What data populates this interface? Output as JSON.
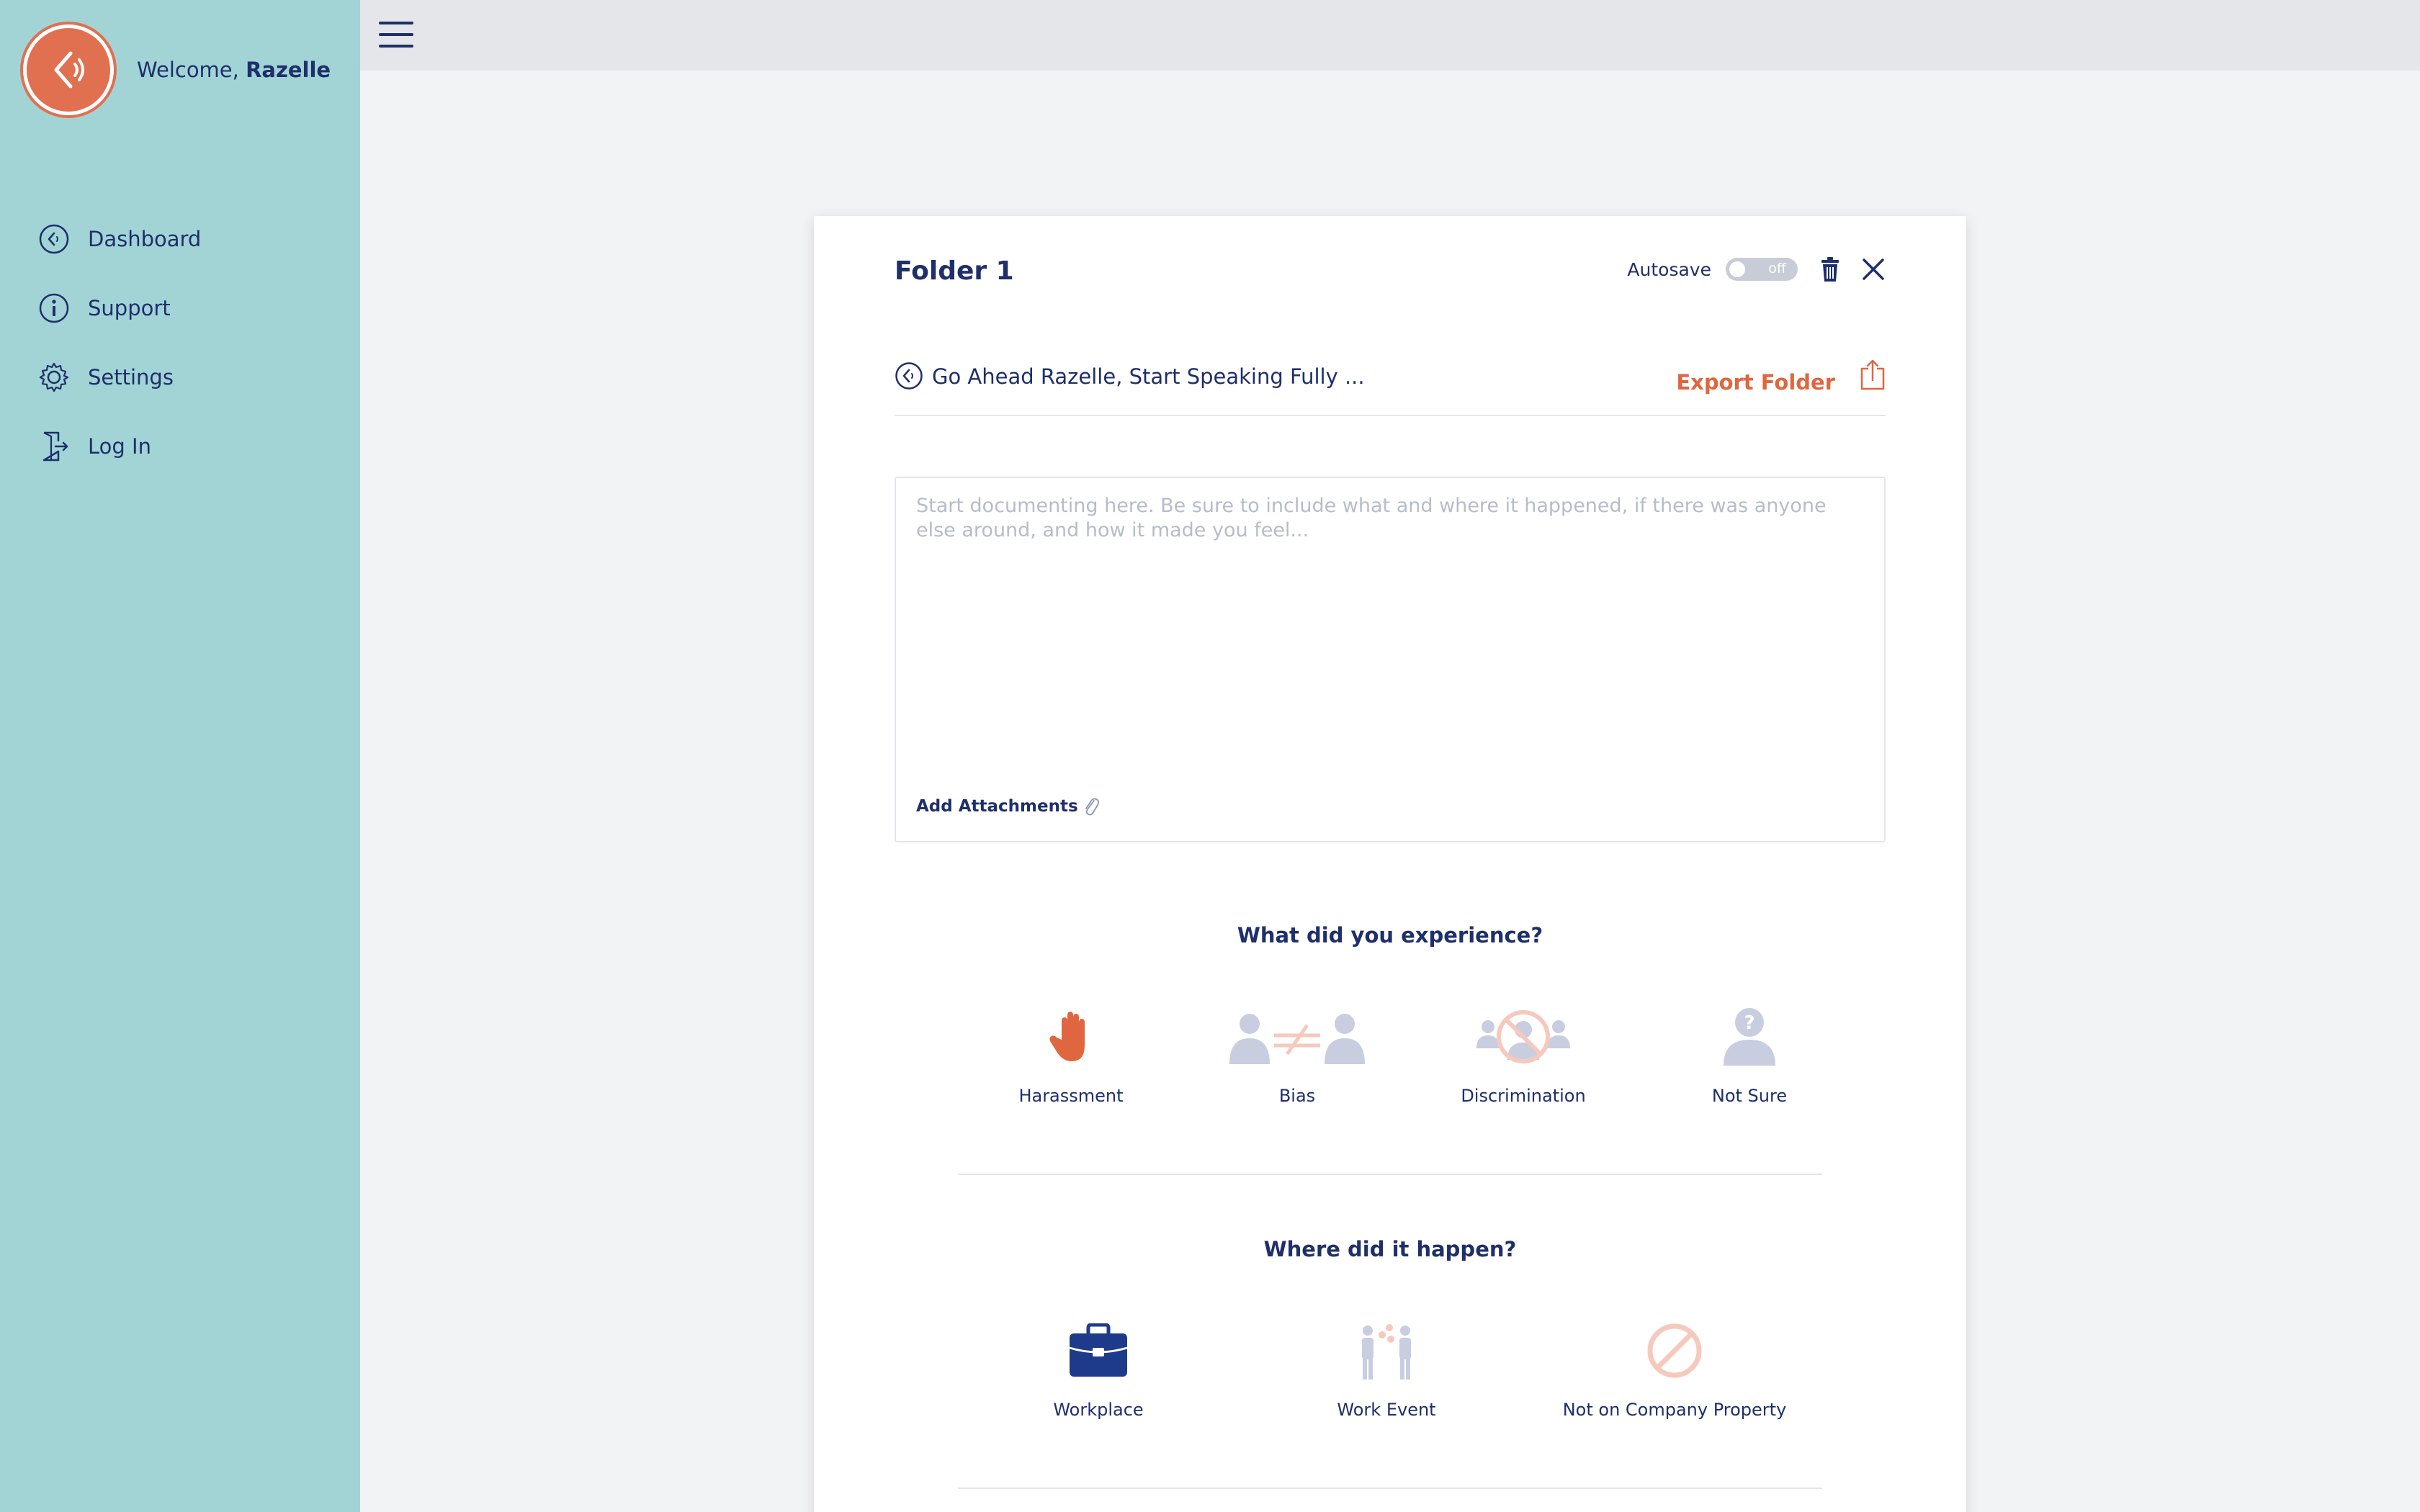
{
  "sidebar": {
    "welcome_prefix": "Welcome,",
    "user_name": "Razelle",
    "nav": [
      {
        "label": "Dashboard",
        "icon": "dashboard-icon"
      },
      {
        "label": "Support",
        "icon": "info-icon"
      },
      {
        "label": "Settings",
        "icon": "gear-icon"
      },
      {
        "label": "Log In",
        "icon": "login-icon"
      }
    ]
  },
  "card": {
    "title": "Folder 1",
    "autosave_label": "Autosave",
    "autosave_state": "off",
    "folder_name": "Go Ahead Razelle, Start Speaking Fully ...",
    "export_label": "Export Folder",
    "doc_placeholder": "Start documenting here. Be sure to include what and where it happened, if there was anyone else around, and how it made you feel...",
    "doc_value": "",
    "attach_label": "Add Attachments"
  },
  "experience": {
    "question": "What did you experience?",
    "options": [
      {
        "label": "Harassment",
        "icon": "raised-hand-icon",
        "selected": true
      },
      {
        "label": "Bias",
        "icon": "not-equal-people-icon",
        "selected": false
      },
      {
        "label": "Discrimination",
        "icon": "prohibited-person-icon",
        "selected": false
      },
      {
        "label": "Not Sure",
        "icon": "question-person-icon",
        "selected": false
      }
    ]
  },
  "location": {
    "question": "Where did it happen?",
    "options": [
      {
        "label": "Workplace",
        "icon": "briefcase-icon",
        "selected": true
      },
      {
        "label": "Work Event",
        "icon": "people-event-icon",
        "selected": false
      },
      {
        "label": "Not on Company Property",
        "icon": "prohibited-icon",
        "selected": false
      }
    ]
  },
  "colors": {
    "sidebar": "#a2d4d6",
    "navy": "#1e2f6b",
    "accent": "#e0663f",
    "muted_icon": "#c9cde0",
    "muted_accent": "#f6c9bd"
  }
}
